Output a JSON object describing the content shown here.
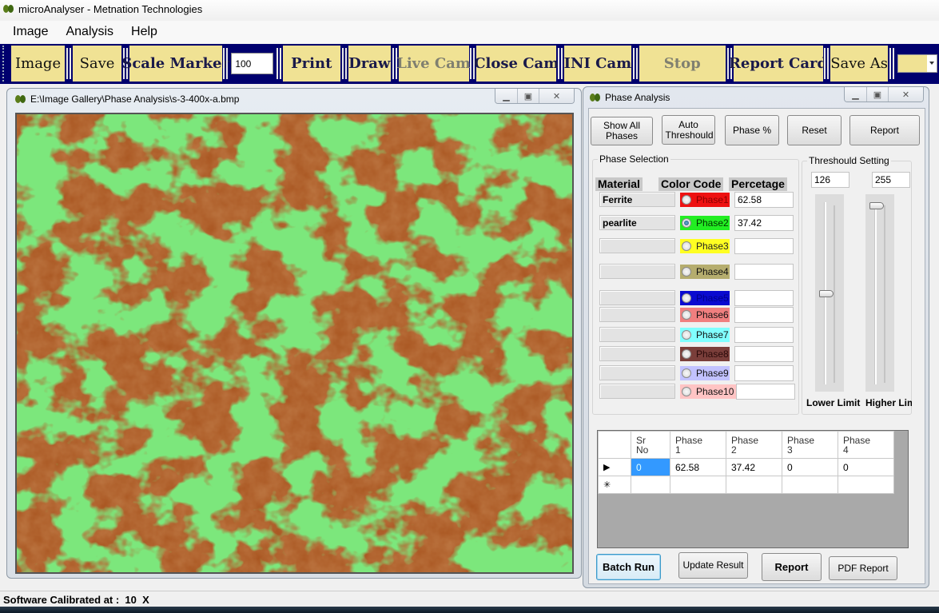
{
  "app": {
    "title": "microAnalyser - Metnation Technologies",
    "icon": "leaf-icon"
  },
  "menu": [
    "Image",
    "Analysis",
    "Help"
  ],
  "toolbar": {
    "image": "Image",
    "save": "Save",
    "scale_marker": "Scale Marker",
    "scale_value": "100",
    "print": "Print",
    "draw": "Draw",
    "live_cam": "Live Cam",
    "close_cam": "Close Cam",
    "ini_cam": "INI Cam",
    "stop": "Stop",
    "report_card": "Report Card",
    "save_as": "Save As",
    "combo_value": ""
  },
  "image_window": {
    "title": "E:\\Image Gallery\\Phase Analysis\\s-3-400x-a.bmp",
    "colors": {
      "phase_overlay": "#33cc33",
      "matrix": "#a04f1e"
    }
  },
  "phase_window": {
    "title": "Phase Analysis",
    "buttons": {
      "show_all": "Show All Phases",
      "auto_threshold": "Auto Threshould",
      "phase_pct": "Phase %",
      "reset": "Reset",
      "report": "Report"
    },
    "phase_selection": {
      "label": "Phase Selection",
      "headers": {
        "material": "Material",
        "color_code": "Color Code",
        "percentage": "Percetage"
      },
      "rows": [
        {
          "material": "Ferrite",
          "phase": "Phase1",
          "color": "#ee1111",
          "text_color": "#8a0000",
          "selected": false,
          "pct": "62.58"
        },
        {
          "material": "pearlite",
          "phase": "Phase2",
          "color": "#22ee22",
          "text_color": "#003300",
          "selected": true,
          "pct": "37.42"
        },
        {
          "material": "",
          "phase": "Phase3",
          "color": "#ffff22",
          "text_color": "#222",
          "selected": false,
          "pct": ""
        },
        {
          "material": "",
          "phase": "Phase4",
          "color": "#b5ad6e",
          "text_color": "#111",
          "selected": false,
          "pct": ""
        },
        {
          "material": "",
          "phase": "Phase5",
          "color": "#0a0ad0",
          "text_color": "#00008a",
          "selected": false,
          "pct": ""
        },
        {
          "material": "",
          "phase": "Phase6",
          "color": "#f07f7f",
          "text_color": "#111",
          "selected": false,
          "pct": ""
        },
        {
          "material": "",
          "phase": "Phase7",
          "color": "#80ffff",
          "text_color": "#111",
          "selected": false,
          "pct": ""
        },
        {
          "material": "",
          "phase": "Phase8",
          "color": "#7a3e3a",
          "text_color": "#2a0a0a",
          "selected": false,
          "pct": ""
        },
        {
          "material": "",
          "phase": "Phase9",
          "color": "#c2c2ff",
          "text_color": "#111",
          "selected": false,
          "pct": ""
        },
        {
          "material": "",
          "phase": "Phase10",
          "color": "#ffc4c4",
          "text_color": "#111",
          "selected": false,
          "pct": ""
        }
      ]
    },
    "threshold": {
      "label": "Threshould Setting",
      "lower_value": "126",
      "higher_value": "255",
      "lower_fraction": 0.49,
      "higher_fraction": 1.0,
      "lower_label": "Lower Limit",
      "higher_label": "Higher Limit"
    },
    "results_table": {
      "columns": [
        "Sr\nNo",
        "Phase\n1",
        "Phase\n2",
        "Phase\n3",
        "Phase\n4"
      ],
      "rows": [
        [
          "0",
          "62.58",
          "37.42",
          "0",
          "0"
        ]
      ],
      "row_indicator": "▶",
      "new_row_indicator": "✳"
    },
    "bottom_buttons": {
      "batch_run": "Batch Run",
      "update_result": "Update Result",
      "report": "Report",
      "pdf_report": "PDF Report"
    }
  },
  "status": {
    "text": "Software Calibrated at :  10  X"
  }
}
